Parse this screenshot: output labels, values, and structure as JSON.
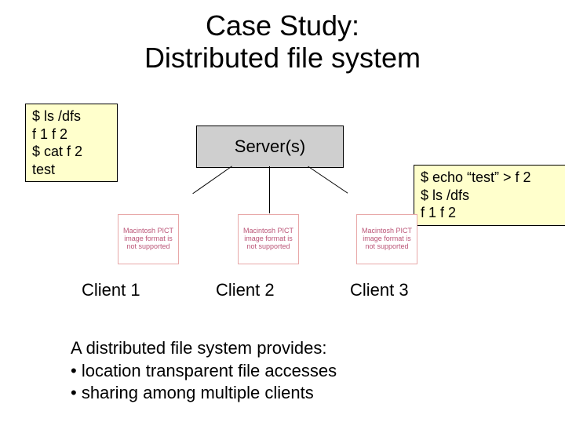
{
  "title_line1": "Case Study:",
  "title_line2": "Distributed file system",
  "callout_left": "$ ls /dfs\nf 1 f 2\n$ cat f 2\ntest",
  "callout_right": "$ echo “test” > f 2\n$ ls /dfs\nf 1 f 2",
  "server_label": "Server(s)",
  "pict_text": "Macintosh PICT image format is not supported",
  "clients": {
    "c1": "Client 1",
    "c2": "Client 2",
    "c3": "Client 3"
  },
  "body_intro": "A distributed file system provides:",
  "body_b1": "• location transparent file accesses",
  "body_b2": "• sharing among multiple clients"
}
